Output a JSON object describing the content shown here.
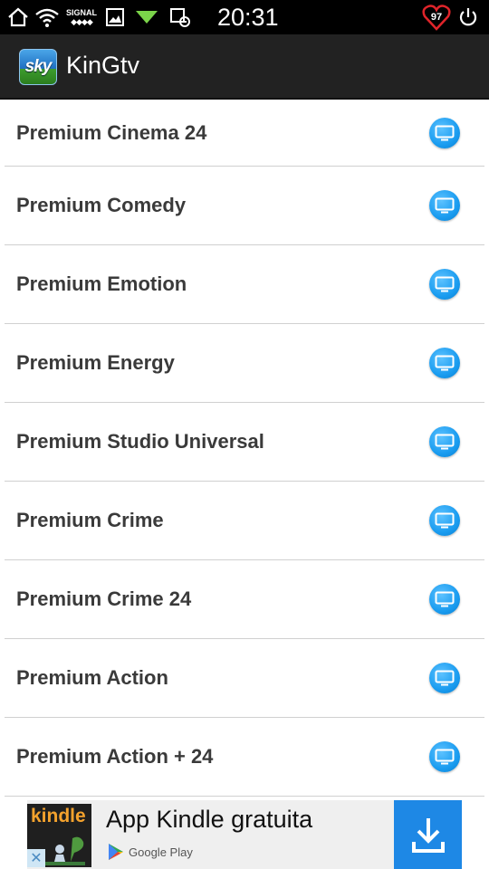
{
  "status_bar": {
    "signal_label": "SIGNAL",
    "time": "20:31",
    "battery": "97",
    "icons": [
      "home-icon",
      "wifi-icon",
      "signal-icon",
      "image-icon",
      "network-icon",
      "nfc-icon",
      "battery-heart-icon",
      "power-icon"
    ]
  },
  "action_bar": {
    "app_icon_text": "sky",
    "title": "KinGtv"
  },
  "channels": [
    {
      "name": "Premium Cinema 24",
      "icon": "tv-icon"
    },
    {
      "name": "Premium Comedy",
      "icon": "tv-icon"
    },
    {
      "name": "Premium Emotion",
      "icon": "tv-icon"
    },
    {
      "name": "Premium Energy",
      "icon": "tv-icon"
    },
    {
      "name": "Premium Studio Universal",
      "icon": "tv-icon"
    },
    {
      "name": "Premium Crime",
      "icon": "tv-icon"
    },
    {
      "name": "Premium Crime 24",
      "icon": "tv-icon"
    },
    {
      "name": "Premium Action",
      "icon": "tv-icon"
    },
    {
      "name": "Premium Action + 24",
      "icon": "tv-icon"
    }
  ],
  "ad": {
    "brand": "kindle",
    "title": "App Kindle gratuita",
    "store": "Google Play",
    "close_glyph": "✕",
    "colors": {
      "accent": "#1e88e5",
      "kindle": "#f4a22d"
    }
  },
  "colors": {
    "status_bar": "#000000",
    "action_bar": "#222222",
    "tv_button": "#1a9cf0",
    "divider": "#d0d0d0",
    "channel_text": "#3a3a3a"
  }
}
